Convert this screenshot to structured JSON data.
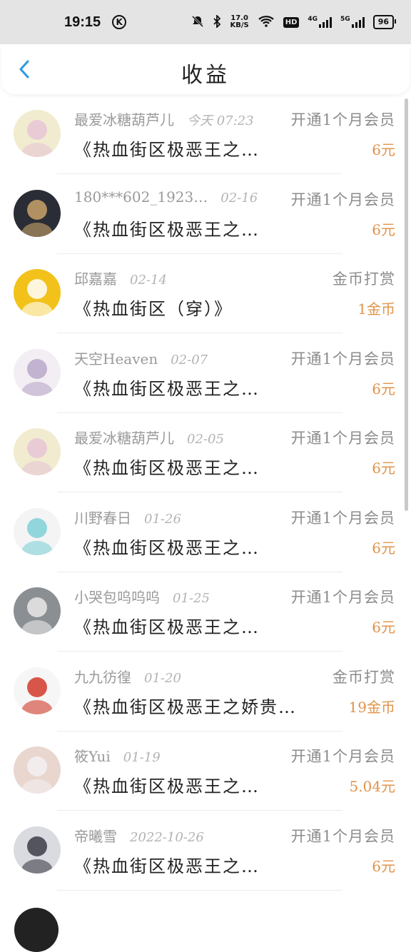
{
  "status_bar": {
    "time": "19:15",
    "k_badge": "K",
    "net_speed_top": "17.0",
    "net_speed_bottom": "KB/S",
    "hd": "HD",
    "net_4g": "4G",
    "net_5g": "5G",
    "battery": "96"
  },
  "header": {
    "title": "收益",
    "back_icon": "chevron-left-icon",
    "accent": "#2a9be0"
  },
  "records": [
    {
      "user": "最爱冰糖葫芦儿",
      "date": "今天 07:23",
      "type": "开通1个月会员",
      "book": "《热血街区极恶王之…",
      "amount": "6元",
      "avatar_color": "#f1ecd0",
      "avatar_accent": "#e8c6d6"
    },
    {
      "user": "180***602_1923…",
      "date": "02-16",
      "type": "开通1个月会员",
      "book": "《热血街区极恶王之…",
      "amount": "6元",
      "avatar_color": "#2a2d35",
      "avatar_accent": "#c9a36a"
    },
    {
      "user": "邱嘉嘉",
      "date": "02-14",
      "type": "金币打赏",
      "book": "《热血街区（穿）》",
      "amount": "1金币",
      "avatar_color": "#f2c21a",
      "avatar_accent": "#ffffff"
    },
    {
      "user": "天空Heaven",
      "date": "02-07",
      "type": "开通1个月会员",
      "book": "《热血街区极恶王之…",
      "amount": "6元",
      "avatar_color": "#f3eef3",
      "avatar_accent": "#b9a8c9"
    },
    {
      "user": "最爱冰糖葫芦儿",
      "date": "02-05",
      "type": "开通1个月会员",
      "book": "《热血街区极恶王之…",
      "amount": "6元",
      "avatar_color": "#f1ecd0",
      "avatar_accent": "#e8c6d6"
    },
    {
      "user": "川野春日",
      "date": "01-26",
      "type": "开通1个月会员",
      "book": "《热血街区极恶王之…",
      "amount": "6元",
      "avatar_color": "#f4f4f4",
      "avatar_accent": "#7fd0d6"
    },
    {
      "user": "小哭包呜呜呜",
      "date": "01-25",
      "type": "开通1个月会员",
      "book": "《热血街区极恶王之…",
      "amount": "6元",
      "avatar_color": "#8a8f93",
      "avatar_accent": "#e9e9e9"
    },
    {
      "user": "九九彷徨",
      "date": "01-20",
      "type": "金币打赏",
      "book": "《热血街区极恶王之娇贵…",
      "amount": "19金币",
      "avatar_color": "#f6f6f6",
      "avatar_accent": "#d23a2a"
    },
    {
      "user": "筱Yui",
      "date": "01-19",
      "type": "开通1个月会员",
      "book": "《热血街区极恶王之…",
      "amount": "5.04元",
      "avatar_color": "#e9d6cf",
      "avatar_accent": "#f4f0f2"
    },
    {
      "user": "帝曦雪",
      "date": "2022-10-26",
      "type": "开通1个月会员",
      "book": "《热血街区极恶王之…",
      "amount": "6元",
      "avatar_color": "#d9dbe0",
      "avatar_accent": "#3c3c46"
    }
  ],
  "amount_color": "#e0934a"
}
